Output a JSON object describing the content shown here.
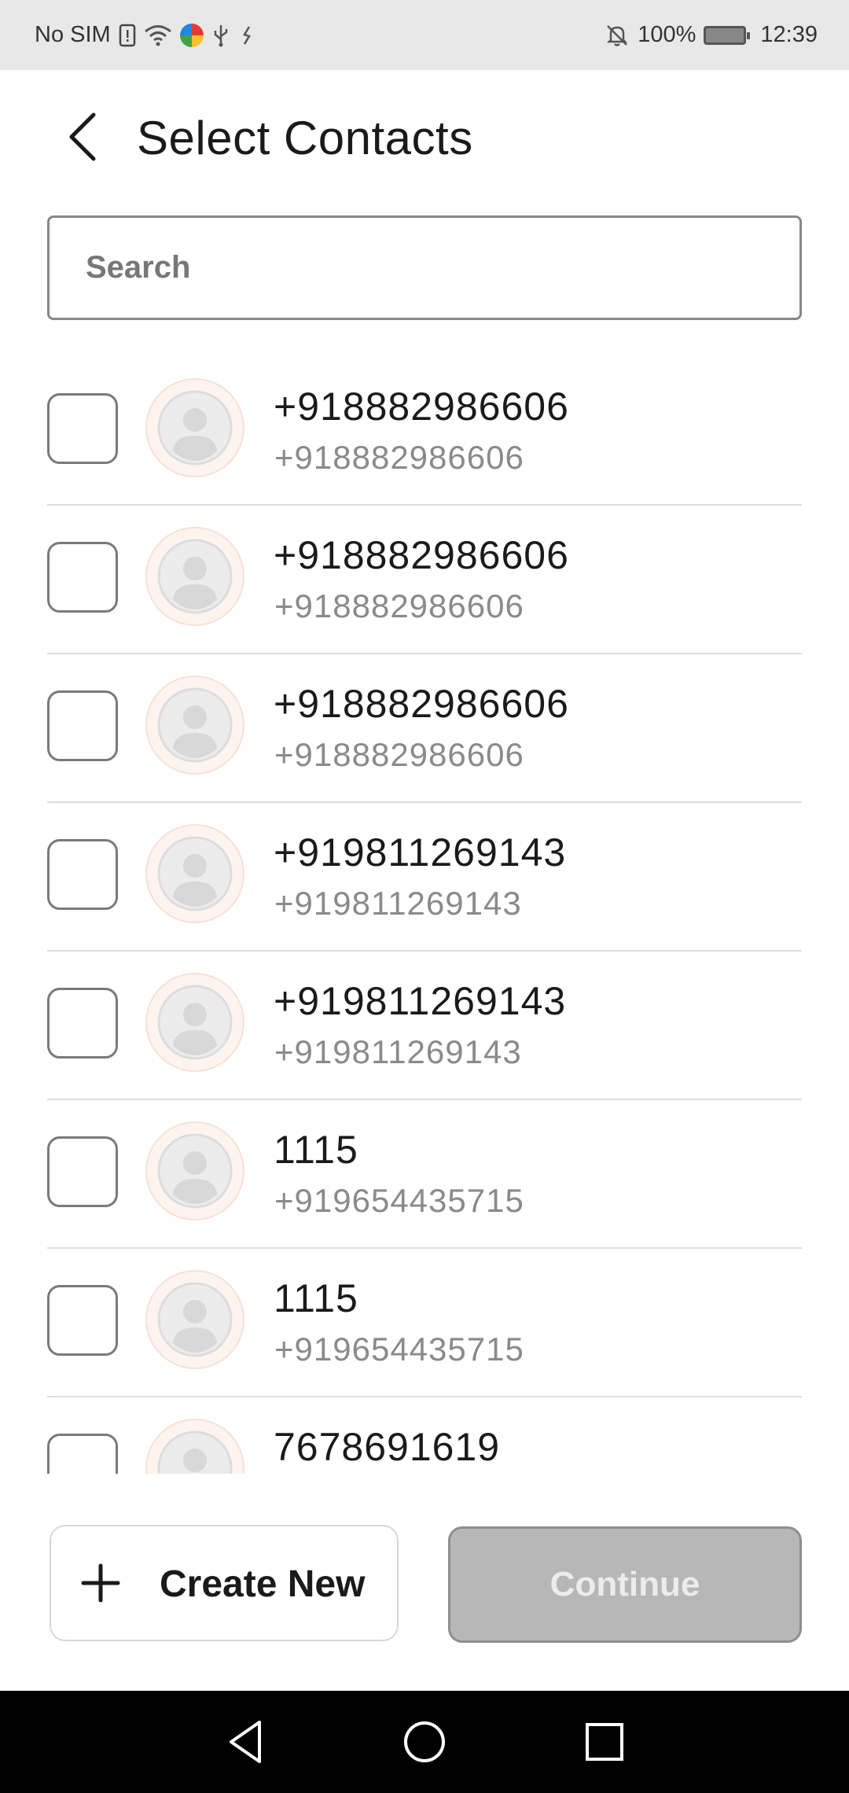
{
  "status_bar": {
    "carrier": "No SIM",
    "battery": "100%",
    "time": "12:39",
    "icons": [
      "sim-alert-icon",
      "wifi-icon",
      "app-color-icon",
      "usb-icon",
      "data-transfer-icon",
      "mute-bell-icon",
      "battery-charging-icon"
    ]
  },
  "header": {
    "back_icon": "chevron-left-icon",
    "title": "Select Contacts"
  },
  "search": {
    "placeholder": "Search",
    "value": ""
  },
  "contacts": [
    {
      "name": "+918882986606",
      "number": "+918882986606",
      "checked": false
    },
    {
      "name": "+918882986606",
      "number": "+918882986606",
      "checked": false
    },
    {
      "name": "+918882986606",
      "number": "+918882986606",
      "checked": false
    },
    {
      "name": "+919811269143",
      "number": "+919811269143",
      "checked": false
    },
    {
      "name": "+919811269143",
      "number": "+919811269143",
      "checked": false
    },
    {
      "name": "1115",
      "number": "+919654435715",
      "checked": false
    },
    {
      "name": "1115",
      "number": "+919654435715",
      "checked": false
    },
    {
      "name": "7678691619",
      "number": "",
      "checked": false
    }
  ],
  "actions": {
    "create_new_label": "Create New",
    "create_icon": "plus-icon",
    "continue_label": "Continue",
    "continue_enabled": false
  },
  "colors": {
    "continue_bg": "#b7b7b7",
    "avatar_bg": "#fdf4f0",
    "status_bar_bg": "#e8e8e8"
  }
}
